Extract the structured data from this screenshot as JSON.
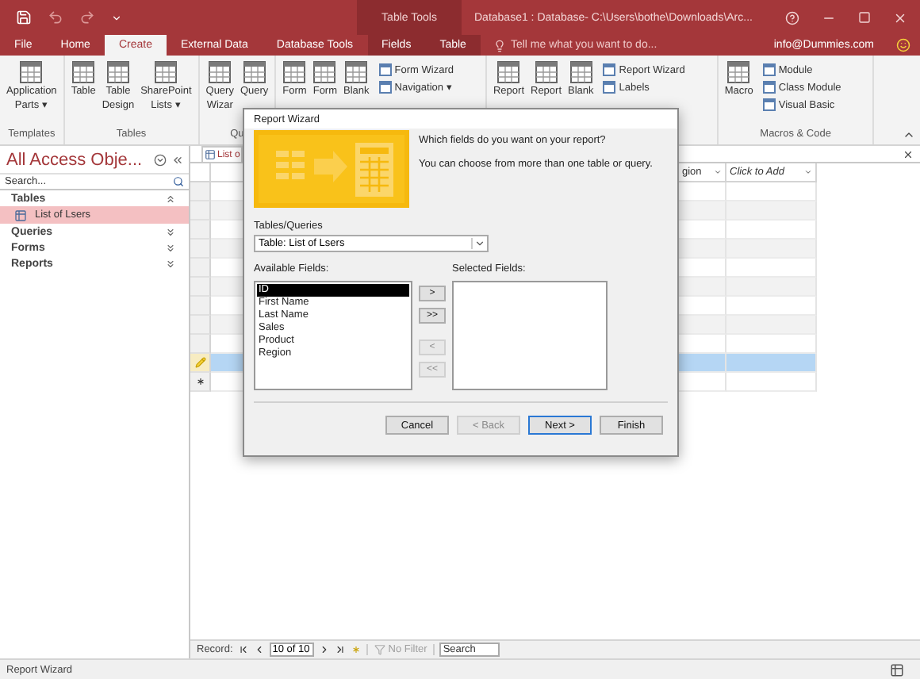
{
  "title_bar": {
    "contextual_tab": "Table Tools",
    "title": "Database1 : Database- C:\\Users\\bothe\\Downloads\\Arc..."
  },
  "ribbon_tabs": [
    {
      "label": "File",
      "selected": false,
      "contextual": false
    },
    {
      "label": "Home",
      "selected": false,
      "contextual": false
    },
    {
      "label": "Create",
      "selected": true,
      "contextual": false
    },
    {
      "label": "External Data",
      "selected": false,
      "contextual": false
    },
    {
      "label": "Database Tools",
      "selected": false,
      "contextual": false
    },
    {
      "label": "Fields",
      "selected": false,
      "contextual": true
    },
    {
      "label": "Table",
      "selected": false,
      "contextual": true
    }
  ],
  "tell_me": {
    "placeholder": "Tell me what you want to do..."
  },
  "account": "info@Dummies.com",
  "ribbon_groups": [
    {
      "label": "Templates",
      "items": [
        {
          "kind": "large",
          "lines": [
            "Application",
            "Parts ▾"
          ]
        }
      ]
    },
    {
      "label": "Tables",
      "items": [
        {
          "kind": "large",
          "lines": [
            "Table"
          ]
        },
        {
          "kind": "large",
          "lines": [
            "Table",
            "Design"
          ]
        },
        {
          "kind": "large",
          "lines": [
            "SharePoint",
            "Lists ▾"
          ]
        }
      ]
    },
    {
      "label": "Qu",
      "items": [
        {
          "kind": "large",
          "lines": [
            "Query",
            "Wizar"
          ]
        },
        {
          "kind": "large",
          "lines": [
            "Query"
          ]
        }
      ]
    },
    {
      "items": [
        {
          "kind": "large",
          "lines": [
            "Form"
          ]
        },
        {
          "kind": "large",
          "lines": [
            "Form"
          ]
        },
        {
          "kind": "large",
          "lines": [
            "Blank"
          ]
        },
        {
          "kind": "stack",
          "entries": [
            "Form Wizard",
            "Navigation ▾"
          ]
        }
      ]
    },
    {
      "items": [
        {
          "kind": "large",
          "lines": [
            "Report"
          ]
        },
        {
          "kind": "large",
          "lines": [
            "Report"
          ]
        },
        {
          "kind": "large",
          "lines": [
            "Blank"
          ]
        },
        {
          "kind": "stack",
          "entries": [
            "Report Wizard",
            "Labels"
          ]
        }
      ]
    },
    {
      "label": "Macros & Code",
      "items": [
        {
          "kind": "large",
          "lines": [
            "Macro"
          ]
        },
        {
          "kind": "stack",
          "entries": [
            "Module",
            "Class Module",
            "Visual Basic"
          ]
        }
      ]
    }
  ],
  "nav_pane": {
    "title": "All Access Obje...",
    "search": {
      "placeholder": "Search..."
    },
    "groups": [
      {
        "label": "Tables",
        "expanded": true,
        "children": [
          {
            "label": "List of Lsers",
            "selected": true
          }
        ]
      },
      {
        "label": "Queries",
        "expanded": false
      },
      {
        "label": "Forms",
        "expanded": false
      },
      {
        "label": "Reports",
        "expanded": false
      }
    ]
  },
  "datasheet": {
    "tab": "List o",
    "columns": [
      {
        "label": "gion",
        "italic": false
      },
      {
        "label": "Click to Add",
        "italic": true
      }
    ],
    "rows": [
      {
        "kind": "record",
        "selected": false,
        "current": false
      },
      {
        "kind": "record",
        "selected": false,
        "current": false
      },
      {
        "kind": "record",
        "selected": false,
        "current": false
      },
      {
        "kind": "record",
        "selected": false,
        "current": false
      },
      {
        "kind": "record",
        "selected": false,
        "current": false
      },
      {
        "kind": "record",
        "selected": false,
        "current": false
      },
      {
        "kind": "record",
        "selected": false,
        "current": false
      },
      {
        "kind": "record",
        "selected": false,
        "current": false
      },
      {
        "kind": "record",
        "selected": false,
        "current": false
      },
      {
        "kind": "record",
        "selected": true,
        "current": true
      },
      {
        "kind": "new",
        "selected": false,
        "current": false
      }
    ]
  },
  "record_bar": {
    "label": "Record:",
    "position": "10 of 10",
    "filter": {
      "label": "No Filter",
      "disabled": true
    },
    "search": {
      "placeholder": "Search"
    }
  },
  "status_bar": {
    "text": "Report Wizard"
  },
  "dialog": {
    "title": "Report Wizard",
    "prompt": "Which fields do you want on your report?",
    "hint": "You can choose from more than one table or query.",
    "source_label": "Tables/Queries",
    "source_value": "Table: List of Lsers",
    "available_label": "Available Fields:",
    "available": [
      {
        "label": "ID",
        "selected": true
      },
      {
        "label": "First Name",
        "selected": false
      },
      {
        "label": "Last Name",
        "selected": false
      },
      {
        "label": "Sales",
        "selected": false
      },
      {
        "label": "Product",
        "selected": false
      },
      {
        "label": "Region",
        "selected": false
      }
    ],
    "selected_label": "Selected Fields:",
    "move_buttons": [
      {
        "label": ">",
        "disabled": false
      },
      {
        "label": ">>",
        "disabled": false
      },
      {
        "label": "<",
        "disabled": true
      },
      {
        "label": "<<",
        "disabled": true
      }
    ],
    "buttons": [
      {
        "label": "Cancel",
        "disabled": false,
        "default": false
      },
      {
        "label": "< Back",
        "disabled": true,
        "default": false
      },
      {
        "label": "Next >",
        "disabled": false,
        "default": true
      },
      {
        "label": "Finish",
        "disabled": false,
        "default": false
      }
    ]
  }
}
